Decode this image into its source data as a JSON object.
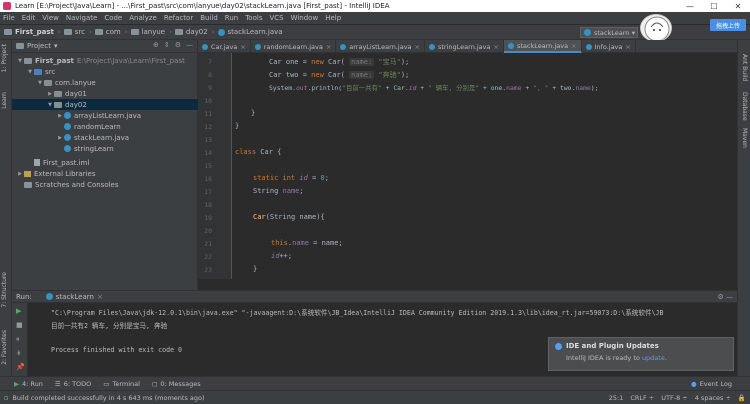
{
  "window": {
    "title": "Learn [E:\\Project\\Java\\Learn] - ...\\First_past\\src\\com\\lanyue\\day02\\stackLearn.java [First_past] - IntelliJ IDEA"
  },
  "menu": [
    "File",
    "Edit",
    "View",
    "Navigate",
    "Code",
    "Analyze",
    "Refactor",
    "Build",
    "Run",
    "Tools",
    "VCS",
    "Window",
    "Help"
  ],
  "breadcrumbs": [
    "First_past",
    "src",
    "com",
    "lanyue",
    "day02",
    "stackLearn.java"
  ],
  "run_config": "stackLearn",
  "upload_label": "拖拽上传",
  "left_tabs": {
    "project": "1: Project",
    "learn": "Learn",
    "structure": "7: Structure",
    "favorites": "2: Favorites"
  },
  "right_tabs": {
    "ant": "Ant Build",
    "database": "Database",
    "maven": "Maven"
  },
  "project_panel": {
    "header": "Project",
    "tree": [
      {
        "label": "First_past",
        "extra": "E:\\Project\\Java\\Learn\\First_past"
      },
      {
        "label": "src"
      },
      {
        "label": "com.lanyue"
      },
      {
        "label": "day01"
      },
      {
        "label": "day02"
      },
      {
        "label": "arrayListLearn.java"
      },
      {
        "label": "randomLearn"
      },
      {
        "label": "stackLearn.java"
      },
      {
        "label": "stringLearn"
      },
      {
        "label": "First_past.iml"
      },
      {
        "label": "External Libraries"
      },
      {
        "label": "Scratches and Consoles"
      }
    ]
  },
  "tabs": [
    "Car.java",
    "randomLearn.java",
    "arrayListLearn.java",
    "stringLearn.java",
    "stackLearn.java",
    "Info.java"
  ],
  "active_tab": "stackLearn.java",
  "line_numbers": [
    "7",
    "8",
    "9",
    "10",
    "11",
    "12",
    "13",
    "14",
    "15",
    "16",
    "17",
    "18",
    "19",
    "20",
    "21",
    "22",
    "23"
  ],
  "code": {
    "l1_a": "Car one = ",
    "l1_kw": "new",
    "l1_b": " Car( ",
    "l1_hint": "name:",
    "l1_str": " \"宝马\"",
    "l1_c": ");",
    "l2_a": "Car two = ",
    "l2_kw": "new",
    "l2_b": " Car( ",
    "l2_hint": "name:",
    "l2_str": " \"奔驰\"",
    "l2_c": ");",
    "l3_a": "System.",
    "l3_out": "out",
    "l3_b": ".println(",
    "l3_s1": "\"目前一共有\"",
    "l3_c": " + Car.",
    "l3_id": "id",
    "l3_d": " + ",
    "l3_s2": "\" 辆车, 分别是\"",
    "l3_e": " + one.",
    "l3_name1": "name",
    "l3_f": " + ",
    "l3_s3": "\", \"",
    "l3_g": " + two.",
    "l3_name2": "name",
    "l3_h": ");",
    "l5": "}",
    "l6": "}",
    "l8_kw": "class",
    "l8_b": " Car {",
    "l10_kw": "static int",
    "l10_id": "id",
    "l10_b": " = ",
    "l10_num": "0",
    "l10_c": ";",
    "l11_a": "String ",
    "l11_name": "name",
    "l11_b": ";",
    "l13_a": "Car",
    "l13_b": "(String name){",
    "l15_kw": "this",
    "l15_b": ".",
    "l15_name": "name",
    "l15_c": " = name;",
    "l16_id": "id",
    "l16_b": "++;",
    "l17": "}"
  },
  "run_panel": {
    "label": "Run:",
    "tab": "stackLearn"
  },
  "console": {
    "cmd": "\"C:\\Program Files\\Java\\jdk-12.0.1\\bin\\java.exe\" \"-javaagent:D:\\系统软件\\JB_Idea\\IntelliJ IDEA Community Edition 2019.1.3\\lib\\idea_rt.jar=59073:D:\\系统软件\\JB",
    "output": "目前一共有2 辆车, 分别是宝马, 奔驰",
    "exit": "Process finished with exit code 0"
  },
  "notification": {
    "title": "IDE and Plugin Updates",
    "body": "IntelliJ IDEA is ready to ",
    "link": "update",
    "tail": "."
  },
  "bottom_tabs": [
    "4: Run",
    "6: TODO",
    "Terminal",
    "0: Messages"
  ],
  "event_log": "Event Log",
  "status": {
    "message": "Build completed successfully in 4 s 643 ms (moments ago)",
    "position": "25:1",
    "line_sep": "CRLF ÷",
    "encoding": "UTF-8 ÷",
    "indent": "4 spaces ÷"
  }
}
